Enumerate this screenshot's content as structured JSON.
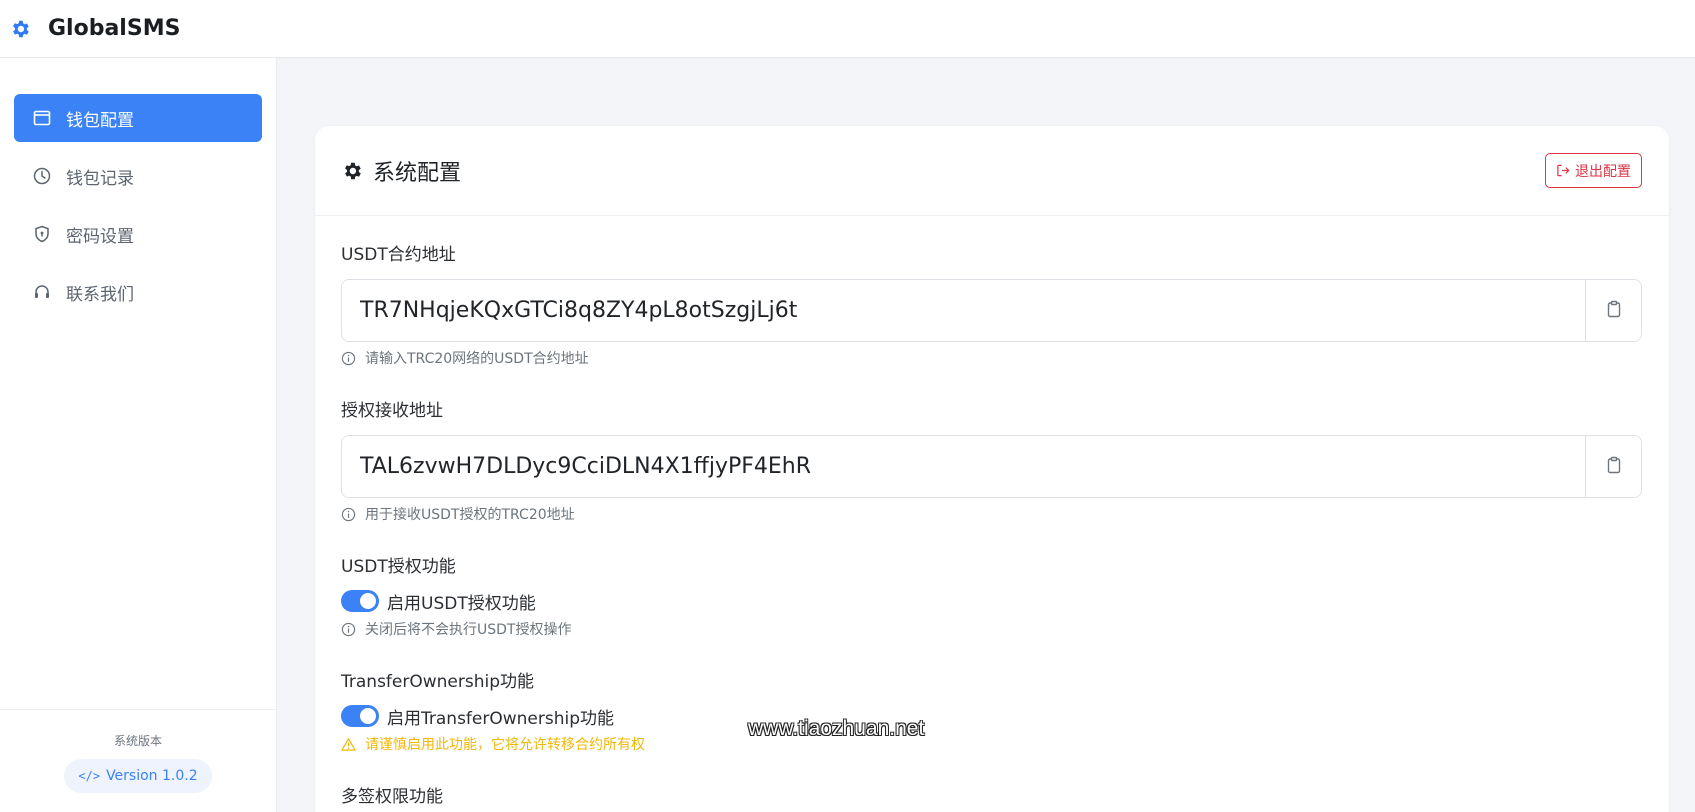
{
  "app": {
    "name": "GlobalSMS",
    "icon": "gear-icon"
  },
  "colors": {
    "primary": "#3b82f6",
    "danger": "#dc3545",
    "warning": "#f2b705"
  },
  "sidebar": {
    "items": [
      {
        "label": "钱包配置",
        "icon": "window-icon",
        "active": true
      },
      {
        "label": "钱包记录",
        "icon": "clock-icon",
        "active": false
      },
      {
        "label": "密码设置",
        "icon": "shield-icon",
        "active": false
      },
      {
        "label": "联系我们",
        "icon": "headset-icon",
        "active": false
      }
    ],
    "footer": {
      "version_label": "系统版本",
      "version": "Version 1.0.2",
      "version_icon": "code-icon"
    }
  },
  "card": {
    "title": "系统配置",
    "title_icon": "gear-icon",
    "exit_button": {
      "label": "退出配置",
      "icon": "logout-icon"
    },
    "fields": [
      {
        "label": "USDT合约地址",
        "value": "TR7NHqjeKQxGTCi8q8ZY4pL8otSzgjLj6t",
        "hint": "请输入TRC20网络的USDT合约地址",
        "paste_icon": "clipboard-icon"
      },
      {
        "label": "授权接收地址",
        "value": "TAL6zvwH7DLDyc9CciDLN4X1ffjyPF4EhR",
        "hint": "用于接收USDT授权的TRC20地址",
        "paste_icon": "clipboard-icon"
      }
    ],
    "toggles": [
      {
        "section": "USDT授权功能",
        "label": "启用USDT授权功能",
        "enabled": true,
        "hint": "关闭后将不会执行USDT授权操作",
        "hint_type": "info"
      },
      {
        "section": "TransferOwnership功能",
        "label": "启用TransferOwnership功能",
        "enabled": true,
        "hint": "请谨慎启用此功能，它将允许转移合约所有权",
        "hint_type": "warning"
      },
      {
        "section": "多签权限功能"
      }
    ]
  },
  "watermark": "www.tiaozhuan.net"
}
